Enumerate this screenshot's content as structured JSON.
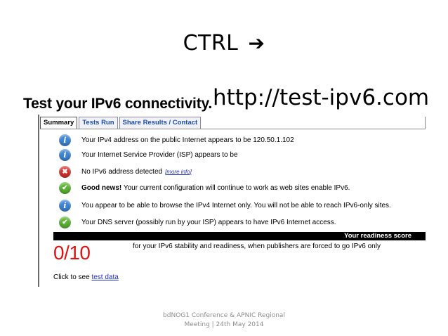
{
  "slide": {
    "title": "CTRL",
    "arrow_glyph": "➔",
    "url": "http://test-ipv6.com"
  },
  "site": {
    "heading": "Test your IPv6 connectivity."
  },
  "tabs": [
    {
      "label": "Summary",
      "active": true
    },
    {
      "label": "Tests Run",
      "active": false
    },
    {
      "label": "Share Results / Contact",
      "active": false
    }
  ],
  "results": [
    {
      "icon": "info-icon",
      "text": "Your IPv4 address on the public Internet appears to be 120.50.1.102"
    },
    {
      "icon": "info-icon",
      "text": "Your Internet Service Provider (ISP) appears to be"
    },
    {
      "icon": "error-icon",
      "text": "No IPv6 address detected",
      "more": "[more info]"
    },
    {
      "icon": "check-icon",
      "strong": "Good news!",
      "text": " Your current configuration will continue to work as web sites enable IPv6."
    },
    {
      "icon": "info-icon",
      "text": "You appear to be able to browse the IPv4 Internet only. You will not be able to reach IPv6-only sites."
    },
    {
      "icon": "check-icon",
      "text": "Your DNS server (possibly run by your ISP) appears to have IPv6 Internet access."
    }
  ],
  "score": {
    "bar_label": "Your readiness score",
    "value": "0/10",
    "description": "for your IPv6 stability and readiness, when publishers are forced to go IPv6 only"
  },
  "click_line": {
    "prefix": "Click to see ",
    "link": "test data"
  },
  "footer": {
    "line1": "bdNOG1 Conference & APNIC Regional",
    "line2": "Meeting | 24th May 2014"
  },
  "colors": {
    "score_red": "#e01313",
    "info_blue": "#3c86d8",
    "ok_green": "#5cb533",
    "error_red": "#d8322d",
    "link_blue": "#1a2fcc"
  }
}
